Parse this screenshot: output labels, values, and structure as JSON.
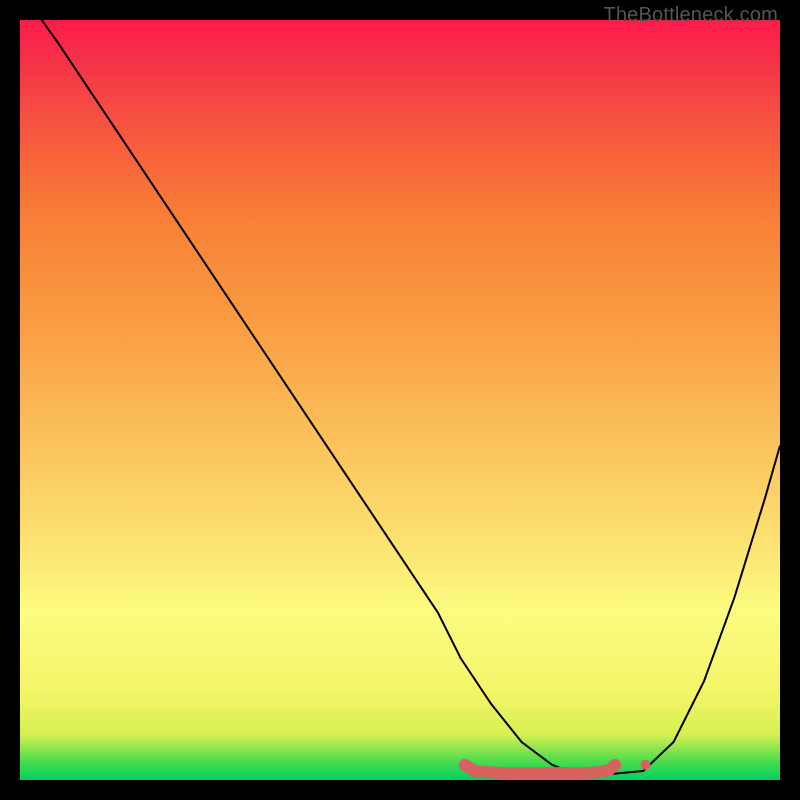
{
  "watermark": "TheBottleneck.com",
  "chart_data": {
    "type": "line",
    "title": "",
    "xlabel": "",
    "ylabel": "",
    "xlim": [
      0,
      100
    ],
    "ylim": [
      0,
      100
    ],
    "grid": false,
    "legend": false,
    "series": [
      {
        "name": "bottleneck-curve",
        "x": [
          0,
          5,
          10,
          15,
          20,
          25,
          30,
          35,
          40,
          45,
          50,
          55,
          58,
          62,
          66,
          70,
          73,
          75,
          78,
          82,
          86,
          90,
          94,
          98,
          100
        ],
        "y": [
          104,
          97,
          89.5,
          82,
          74.5,
          67,
          59.5,
          52,
          44.5,
          37,
          29.5,
          22,
          16,
          10,
          5,
          2,
          0.8,
          0.8,
          0.8,
          1.2,
          5,
          13,
          24,
          37,
          44
        ],
        "color": "#000000",
        "width": 2
      },
      {
        "name": "highlight-flat-region",
        "x": [
          58.5,
          60,
          64,
          68,
          72,
          74,
          76,
          77.5,
          78.3
        ],
        "y": [
          2.0,
          1.1,
          0.9,
          0.9,
          0.9,
          0.9,
          1.0,
          1.3,
          2.0
        ],
        "color": "#d86262",
        "width": 12
      },
      {
        "name": "highlight-dot",
        "x": [
          82.3
        ],
        "y": [
          2.0
        ],
        "color": "#d86262",
        "type": "scatter",
        "size": 10
      }
    ],
    "background_gradient": {
      "direction": "vertical",
      "stops": [
        {
          "pos": 0.0,
          "color": "#00d060"
        },
        {
          "pos": 0.06,
          "color": "#d8f050"
        },
        {
          "pos": 0.22,
          "color": "#fcfc80"
        },
        {
          "pos": 0.5,
          "color": "#fab050"
        },
        {
          "pos": 0.8,
          "color": "#f76a38"
        },
        {
          "pos": 1.0,
          "color": "#ff1a4c"
        }
      ]
    }
  }
}
